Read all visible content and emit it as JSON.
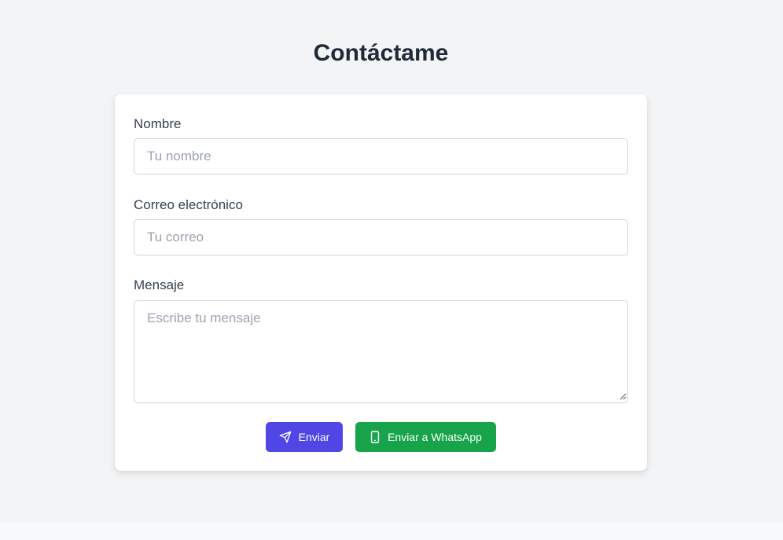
{
  "page": {
    "title": "Contáctame"
  },
  "form": {
    "name_label": "Nombre",
    "name_placeholder": "Tu nombre",
    "name_value": "",
    "email_label": "Correo electrónico",
    "email_placeholder": "Tu correo",
    "email_value": "",
    "message_label": "Mensaje",
    "message_placeholder": "Escribe tu mensaje",
    "message_value": "",
    "send_label": "Enviar",
    "send_icon": "send-icon",
    "whatsapp_label": "Enviar a WhatsApp",
    "whatsapp_icon": "smartphone-icon"
  },
  "colors": {
    "background": "#f3f4f6",
    "primary": "#4f46e5",
    "whatsapp": "#16a34a",
    "heading": "#1f2937"
  }
}
